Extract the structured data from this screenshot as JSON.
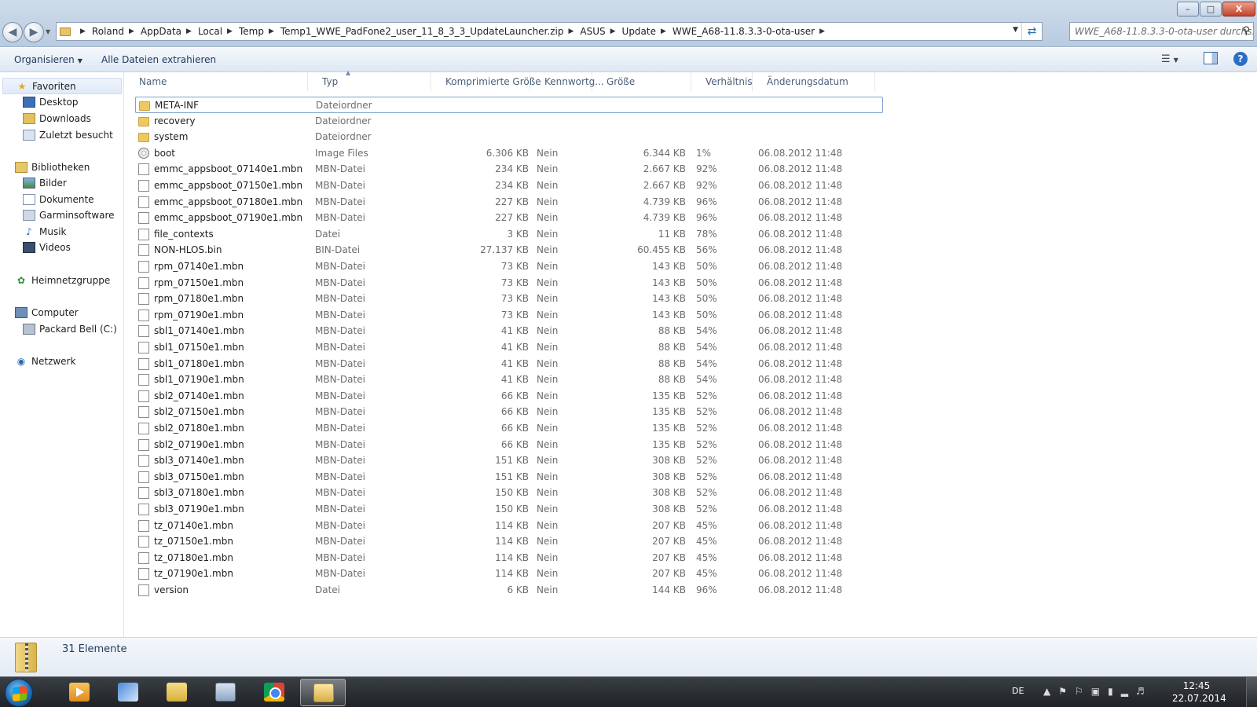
{
  "window": {
    "controls": {
      "minimize": "–",
      "maximize": "□",
      "close": "X"
    }
  },
  "address": {
    "crumbs": [
      "Roland",
      "AppData",
      "Local",
      "Temp",
      "Temp1_WWE_PadFone2_user_11_8_3_3_UpdateLauncher.zip",
      "ASUS",
      "Update",
      "WWE_A68-11.8.3.3-0-ota-user"
    ],
    "search_placeholder": "WWE_A68-11.8.3.3-0-ota-user durchs..."
  },
  "toolbar": {
    "organize_label": "Organisieren",
    "extract_label": "Alle Dateien extrahieren"
  },
  "nav": {
    "favorites": {
      "label": "Favoriten",
      "items": [
        "Desktop",
        "Downloads",
        "Zuletzt besucht"
      ]
    },
    "libraries": {
      "label": "Bibliotheken",
      "items": [
        "Bilder",
        "Dokumente",
        "Garminsoftware",
        "Musik",
        "Videos"
      ]
    },
    "homegroup": "Heimnetzgruppe",
    "computer": {
      "label": "Computer",
      "items": [
        "Packard Bell (C:)"
      ]
    },
    "network": "Netzwerk"
  },
  "columns": [
    "Name",
    "Typ",
    "Komprimierte Größe",
    "Kennwortg...",
    "Größe",
    "Verhältnis",
    "Änderungsdatum"
  ],
  "files": [
    {
      "icon": "folder",
      "name": "META-INF",
      "type": "Dateiordner",
      "comp": "",
      "pw": "",
      "size": "",
      "ratio": "",
      "date": ""
    },
    {
      "icon": "folder",
      "name": "recovery",
      "type": "Dateiordner",
      "comp": "",
      "pw": "",
      "size": "",
      "ratio": "",
      "date": ""
    },
    {
      "icon": "folder",
      "name": "system",
      "type": "Dateiordner",
      "comp": "",
      "pw": "",
      "size": "",
      "ratio": "",
      "date": ""
    },
    {
      "icon": "disc",
      "name": "boot",
      "type": "Image Files",
      "comp": "6.306 KB",
      "pw": "Nein",
      "size": "6.344 KB",
      "ratio": "1%",
      "date": "06.08.2012 11:48"
    },
    {
      "icon": "file",
      "name": "emmc_appsboot_07140e1.mbn",
      "type": "MBN-Datei",
      "comp": "234 KB",
      "pw": "Nein",
      "size": "2.667 KB",
      "ratio": "92%",
      "date": "06.08.2012 11:48"
    },
    {
      "icon": "file",
      "name": "emmc_appsboot_07150e1.mbn",
      "type": "MBN-Datei",
      "comp": "234 KB",
      "pw": "Nein",
      "size": "2.667 KB",
      "ratio": "92%",
      "date": "06.08.2012 11:48"
    },
    {
      "icon": "file",
      "name": "emmc_appsboot_07180e1.mbn",
      "type": "MBN-Datei",
      "comp": "227 KB",
      "pw": "Nein",
      "size": "4.739 KB",
      "ratio": "96%",
      "date": "06.08.2012 11:48"
    },
    {
      "icon": "file",
      "name": "emmc_appsboot_07190e1.mbn",
      "type": "MBN-Datei",
      "comp": "227 KB",
      "pw": "Nein",
      "size": "4.739 KB",
      "ratio": "96%",
      "date": "06.08.2012 11:48"
    },
    {
      "icon": "file",
      "name": "file_contexts",
      "type": "Datei",
      "comp": "3 KB",
      "pw": "Nein",
      "size": "11 KB",
      "ratio": "78%",
      "date": "06.08.2012 11:48"
    },
    {
      "icon": "file",
      "name": "NON-HLOS.bin",
      "type": "BIN-Datei",
      "comp": "27.137 KB",
      "pw": "Nein",
      "size": "60.455 KB",
      "ratio": "56%",
      "date": "06.08.2012 11:48"
    },
    {
      "icon": "file",
      "name": "rpm_07140e1.mbn",
      "type": "MBN-Datei",
      "comp": "73 KB",
      "pw": "Nein",
      "size": "143 KB",
      "ratio": "50%",
      "date": "06.08.2012 11:48"
    },
    {
      "icon": "file",
      "name": "rpm_07150e1.mbn",
      "type": "MBN-Datei",
      "comp": "73 KB",
      "pw": "Nein",
      "size": "143 KB",
      "ratio": "50%",
      "date": "06.08.2012 11:48"
    },
    {
      "icon": "file",
      "name": "rpm_07180e1.mbn",
      "type": "MBN-Datei",
      "comp": "73 KB",
      "pw": "Nein",
      "size": "143 KB",
      "ratio": "50%",
      "date": "06.08.2012 11:48"
    },
    {
      "icon": "file",
      "name": "rpm_07190e1.mbn",
      "type": "MBN-Datei",
      "comp": "73 KB",
      "pw": "Nein",
      "size": "143 KB",
      "ratio": "50%",
      "date": "06.08.2012 11:48"
    },
    {
      "icon": "file",
      "name": "sbl1_07140e1.mbn",
      "type": "MBN-Datei",
      "comp": "41 KB",
      "pw": "Nein",
      "size": "88 KB",
      "ratio": "54%",
      "date": "06.08.2012 11:48"
    },
    {
      "icon": "file",
      "name": "sbl1_07150e1.mbn",
      "type": "MBN-Datei",
      "comp": "41 KB",
      "pw": "Nein",
      "size": "88 KB",
      "ratio": "54%",
      "date": "06.08.2012 11:48"
    },
    {
      "icon": "file",
      "name": "sbl1_07180e1.mbn",
      "type": "MBN-Datei",
      "comp": "41 KB",
      "pw": "Nein",
      "size": "88 KB",
      "ratio": "54%",
      "date": "06.08.2012 11:48"
    },
    {
      "icon": "file",
      "name": "sbl1_07190e1.mbn",
      "type": "MBN-Datei",
      "comp": "41 KB",
      "pw": "Nein",
      "size": "88 KB",
      "ratio": "54%",
      "date": "06.08.2012 11:48"
    },
    {
      "icon": "file",
      "name": "sbl2_07140e1.mbn",
      "type": "MBN-Datei",
      "comp": "66 KB",
      "pw": "Nein",
      "size": "135 KB",
      "ratio": "52%",
      "date": "06.08.2012 11:48"
    },
    {
      "icon": "file",
      "name": "sbl2_07150e1.mbn",
      "type": "MBN-Datei",
      "comp": "66 KB",
      "pw": "Nein",
      "size": "135 KB",
      "ratio": "52%",
      "date": "06.08.2012 11:48"
    },
    {
      "icon": "file",
      "name": "sbl2_07180e1.mbn",
      "type": "MBN-Datei",
      "comp": "66 KB",
      "pw": "Nein",
      "size": "135 KB",
      "ratio": "52%",
      "date": "06.08.2012 11:48"
    },
    {
      "icon": "file",
      "name": "sbl2_07190e1.mbn",
      "type": "MBN-Datei",
      "comp": "66 KB",
      "pw": "Nein",
      "size": "135 KB",
      "ratio": "52%",
      "date": "06.08.2012 11:48"
    },
    {
      "icon": "file",
      "name": "sbl3_07140e1.mbn",
      "type": "MBN-Datei",
      "comp": "151 KB",
      "pw": "Nein",
      "size": "308 KB",
      "ratio": "52%",
      "date": "06.08.2012 11:48"
    },
    {
      "icon": "file",
      "name": "sbl3_07150e1.mbn",
      "type": "MBN-Datei",
      "comp": "151 KB",
      "pw": "Nein",
      "size": "308 KB",
      "ratio": "52%",
      "date": "06.08.2012 11:48"
    },
    {
      "icon": "file",
      "name": "sbl3_07180e1.mbn",
      "type": "MBN-Datei",
      "comp": "150 KB",
      "pw": "Nein",
      "size": "308 KB",
      "ratio": "52%",
      "date": "06.08.2012 11:48"
    },
    {
      "icon": "file",
      "name": "sbl3_07190e1.mbn",
      "type": "MBN-Datei",
      "comp": "150 KB",
      "pw": "Nein",
      "size": "308 KB",
      "ratio": "52%",
      "date": "06.08.2012 11:48"
    },
    {
      "icon": "file",
      "name": "tz_07140e1.mbn",
      "type": "MBN-Datei",
      "comp": "114 KB",
      "pw": "Nein",
      "size": "207 KB",
      "ratio": "45%",
      "date": "06.08.2012 11:48"
    },
    {
      "icon": "file",
      "name": "tz_07150e1.mbn",
      "type": "MBN-Datei",
      "comp": "114 KB",
      "pw": "Nein",
      "size": "207 KB",
      "ratio": "45%",
      "date": "06.08.2012 11:48"
    },
    {
      "icon": "file",
      "name": "tz_07180e1.mbn",
      "type": "MBN-Datei",
      "comp": "114 KB",
      "pw": "Nein",
      "size": "207 KB",
      "ratio": "45%",
      "date": "06.08.2012 11:48"
    },
    {
      "icon": "file",
      "name": "tz_07190e1.mbn",
      "type": "MBN-Datei",
      "comp": "114 KB",
      "pw": "Nein",
      "size": "207 KB",
      "ratio": "45%",
      "date": "06.08.2012 11:48"
    },
    {
      "icon": "file",
      "name": "version",
      "type": "Datei",
      "comp": "6 KB",
      "pw": "Nein",
      "size": "144 KB",
      "ratio": "96%",
      "date": "06.08.2012 11:48"
    }
  ],
  "status": {
    "count": "31 Elemente"
  },
  "taskbar": {
    "apps": [
      "media-player-icon",
      "paint-icon",
      "folders-icon",
      "calculator-icon",
      "chrome-icon",
      "explorer-icon"
    ],
    "active_app": "explorer-icon",
    "lang": "DE",
    "time": "12:45",
    "date": "22.07.2014"
  }
}
